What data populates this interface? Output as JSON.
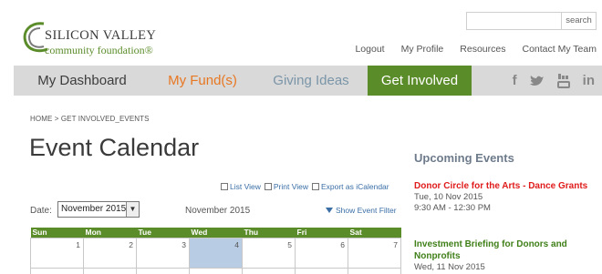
{
  "logo": {
    "line1": "SILICON VALLEY",
    "line2": "community foundation®"
  },
  "search": {
    "placeholder": "",
    "button_label": "search"
  },
  "toplinks": [
    "Logout",
    "My Profile",
    "Resources",
    "Contact My Team"
  ],
  "nav": {
    "items": [
      {
        "label": "My Dashboard"
      },
      {
        "label": "My Fund(s)"
      },
      {
        "label": "Giving Ideas"
      },
      {
        "label": "Get Involved"
      }
    ],
    "social": [
      "facebook-icon",
      "twitter-icon",
      "youtube-icon",
      "linkedin-icon"
    ]
  },
  "breadcrumb": "HOME > GET INVOLVED_EVENTS",
  "page_title": "Event Calendar",
  "views": {
    "list": "List View",
    "print": "Print View",
    "export": "Export as iCalendar"
  },
  "date": {
    "label": "Date:",
    "selected": "November 2015",
    "month_label": "November 2015",
    "filter_label": "Show Event Filter"
  },
  "calendar": {
    "days": [
      "Sun",
      "Mon",
      "Tue",
      "Wed",
      "Thu",
      "Fri",
      "Sat"
    ],
    "week1": [
      "1",
      "2",
      "3",
      "4",
      "5",
      "6",
      "7"
    ]
  },
  "sidebar": {
    "title": "Upcoming Events",
    "events": [
      {
        "title": "Donor Circle for the Arts - Dance Grants",
        "date": "Tue, 10 Nov 2015",
        "time": "9:30 AM - 12:30 PM"
      },
      {
        "title": "Investment Briefing for Donors and Nonprofits",
        "date": "Wed, 11 Nov 2015"
      }
    ]
  },
  "colors": {
    "brand_green": "#5b8c2a",
    "orange": "#e87722",
    "event_red": "#e01b1b",
    "today_blue": "#b8cce4"
  }
}
